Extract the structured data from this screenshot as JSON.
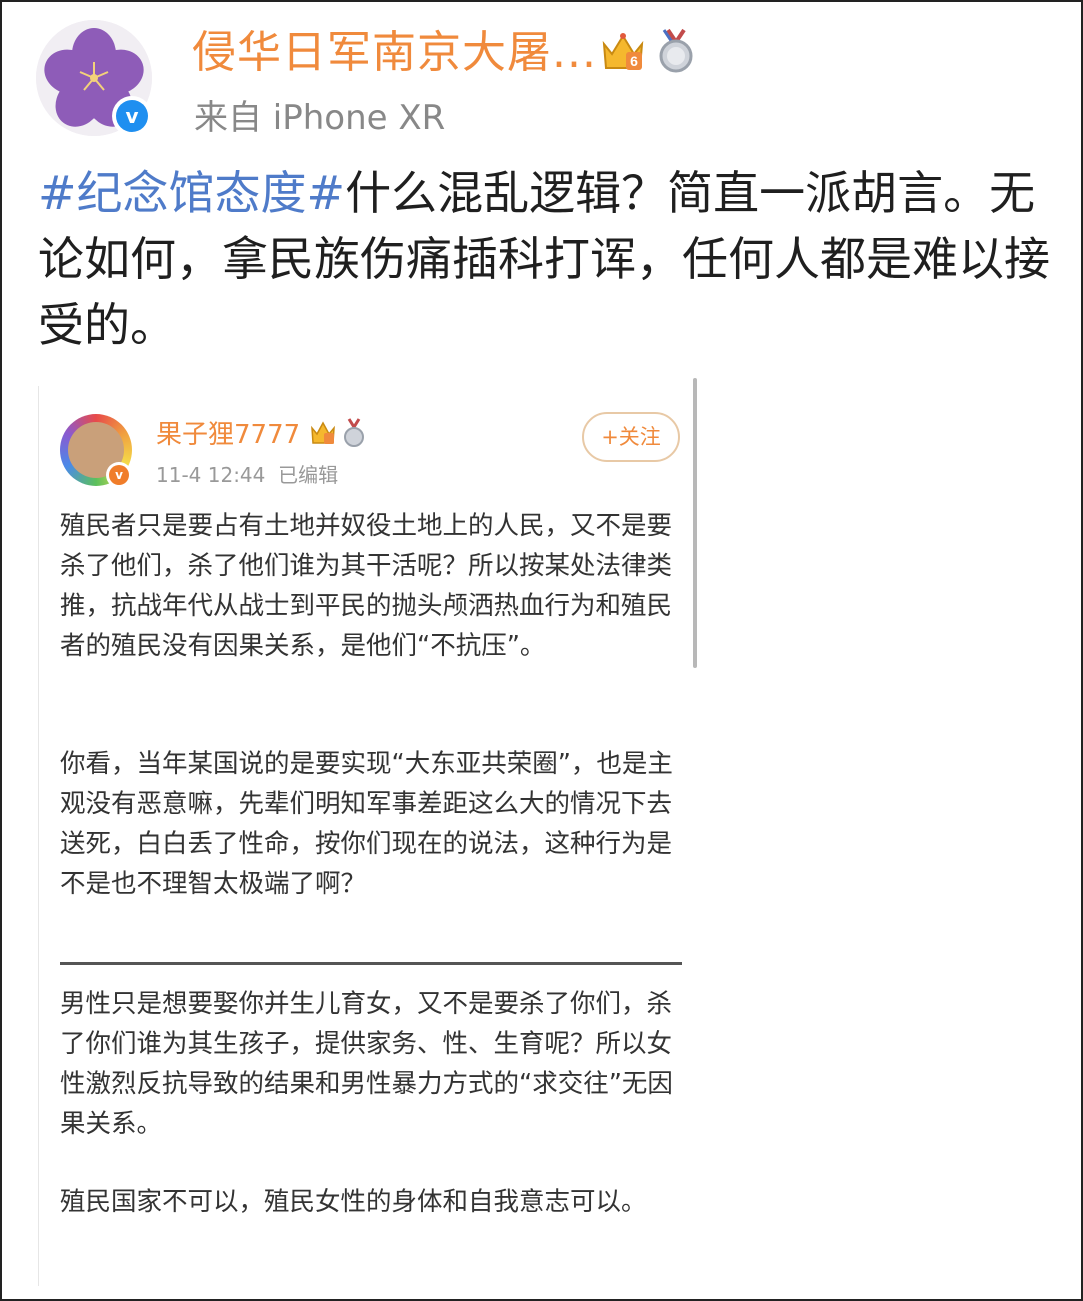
{
  "post": {
    "username": "侵华日军南京大屠...",
    "source": "来自 iPhone XR",
    "hashtag": "#纪念馆态度#",
    "text": "什么混乱逻辑？简直一派胡言。无论如何，拿民族伤痛插科打诨，任何人都是难以接受的。",
    "crown_badge_level": "6",
    "verified_mark": "v"
  },
  "embedded": {
    "username": "果子狸7777",
    "timestamp": "11-4 12:44",
    "edited": "已编辑",
    "follow_label": "+关注",
    "verified_mark": "v",
    "paragraphs": [
      "殖民者只是要占有土地并奴役土地上的人民，又不是要杀了他们，杀了他们谁为其干活呢？所以按某处法律类推，抗战年代从战士到平民的抛头颅洒热血行为和殖民者的殖民没有因果关系，是他们“不抗压”。",
      "你看，当年某国说的是要实现“大东亚共荣圈”，也是主观没有恶意嘛，先辈们明知军事差距这么大的情况下去送死，白白丢了性命，按你们现在的说法，这种行为是不是也不理智太极端了啊？",
      "男性只是想要娶你并生儿育女，又不是要杀了你们，杀了你们谁为其生孩子，提供家务、性、生育呢？所以女性激烈反抗导致的结果和男性暴力方式的“求交往”无因果关系。",
      "殖民国家不可以，殖民女性的身体和自我意志可以。"
    ]
  },
  "colors": {
    "username": "#f08a3c",
    "hashtag": "#4f7bc9",
    "verified_blue": "#1f8ff0",
    "secondary_text": "#888888"
  },
  "icons": [
    "flower-avatar",
    "verified-icon",
    "crown-badge-icon",
    "medal-badge-icon",
    "follow-button"
  ]
}
